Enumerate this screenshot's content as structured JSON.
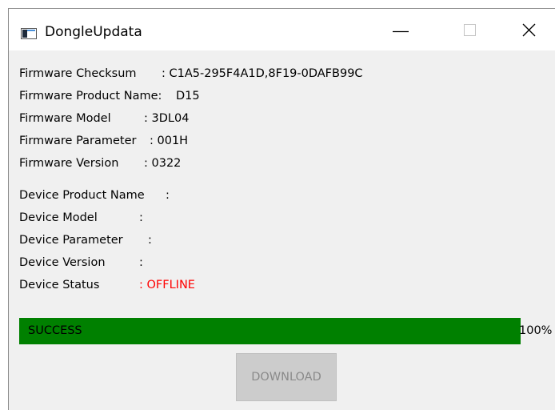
{
  "window": {
    "title": "DongleUpdata",
    "icon": "app-window-icon"
  },
  "title_controls": {
    "minimize_icon": "minimize-icon",
    "maximize_icon": "maximize-icon",
    "close_icon": "close-icon"
  },
  "firmware": {
    "checksum_label": "Firmware Checksum",
    "checksum_value": ": C1A5-295F4A1D,8F19-0DAFB99C",
    "product_name_label": "Firmware Product Name:",
    "product_name_value": "D15",
    "model_label": "Firmware Model",
    "model_value": ": 3DL04",
    "parameter_label": "Firmware Parameter",
    "parameter_value": ": 001H",
    "version_label": "Firmware Version",
    "version_value": ": 0322"
  },
  "device": {
    "product_name_label": "Device Product Name",
    "product_name_value": ":",
    "model_label": "Device Model",
    "model_value": ":",
    "parameter_label": "Device Parameter",
    "parameter_value": ":",
    "version_label": "Device Version",
    "version_value": ":",
    "status_label": "Device Status",
    "status_value": ": OFFLINE"
  },
  "progress": {
    "status_text": "SUCCESS",
    "percent_text": "100%",
    "fraction": 1.0
  },
  "actions": {
    "download_label": "DOWNLOAD",
    "download_enabled": false
  },
  "colors": {
    "progress_fill": "#008000",
    "offline_text": "#ff0000",
    "window_bg": "#f0f0f0",
    "disabled_button_bg": "#cccccc"
  }
}
